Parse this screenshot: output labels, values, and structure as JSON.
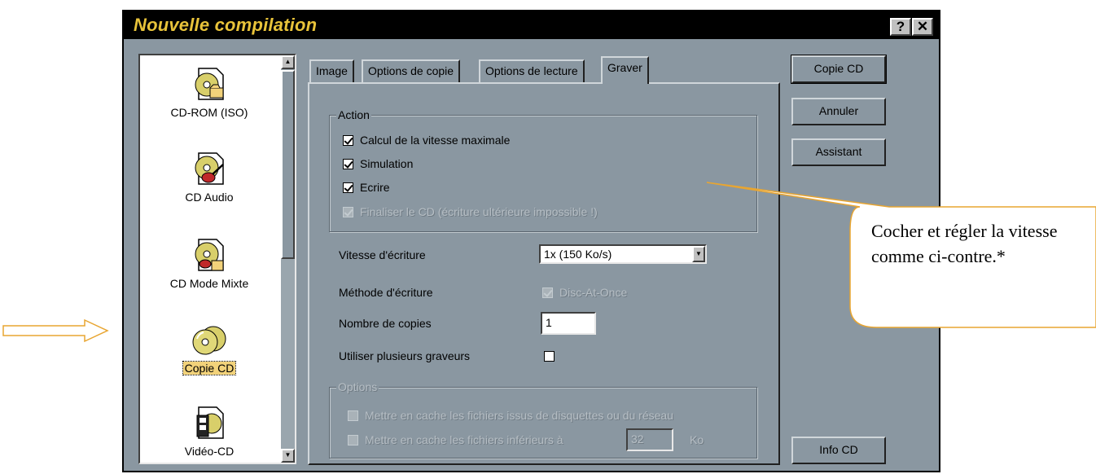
{
  "window": {
    "title": "Nouvelle compilation",
    "help_label": "?",
    "close_label": "✕"
  },
  "compilation_types": [
    {
      "label": "CD-ROM (ISO)",
      "icon": "cd-rom-document-icon",
      "selected": false
    },
    {
      "label": "CD Audio",
      "icon": "cd-audio-guitar-icon",
      "selected": false
    },
    {
      "label": "CD Mode Mixte",
      "icon": "cd-mixed-mode-icon",
      "selected": false
    },
    {
      "label": "Copie CD",
      "icon": "cd-copy-icon",
      "selected": true
    },
    {
      "label": "Vidéo-CD",
      "icon": "video-cd-film-icon",
      "selected": false
    }
  ],
  "tabs": [
    {
      "label": "Image",
      "active": false
    },
    {
      "label": "Options de copie",
      "active": false
    },
    {
      "label": "Options de lecture",
      "active": false
    },
    {
      "label": "Graver",
      "active": true
    }
  ],
  "action_group": {
    "title": "Action",
    "items": [
      {
        "label": "Calcul de la vitesse maximale",
        "checked": true,
        "enabled": true
      },
      {
        "label": "Simulation",
        "checked": true,
        "enabled": true
      },
      {
        "label": "Ecrire",
        "checked": true,
        "enabled": true
      },
      {
        "label": "Finaliser le CD (écriture ultérieure impossible !)",
        "checked": true,
        "enabled": false
      }
    ]
  },
  "write_speed": {
    "label": "Vitesse d'écriture",
    "value": "1x (150 Ko/s)"
  },
  "write_method": {
    "label": "Méthode d'écriture",
    "value": "Disc-At-Once",
    "checked": true,
    "enabled": false
  },
  "copies": {
    "label": "Nombre de copies",
    "value": "1"
  },
  "multiple_writers": {
    "label": "Utiliser plusieurs graveurs",
    "checked": false
  },
  "options_group": {
    "title": "Options",
    "cache_network": "Mettre en cache les fichiers issus de disquettes ou du réseau",
    "cache_smaller": "Mettre en cache les fichiers inférieurs à",
    "cache_size": "32",
    "cache_unit": "Ko"
  },
  "buttons": {
    "copy_cd": "Copie CD",
    "cancel": "Annuler",
    "wizard": "Assistant",
    "cd_info": "Info CD"
  },
  "annotation": {
    "callout_text": "Cocher et régler la vitesse comme ci-contre.*"
  },
  "colors": {
    "dialog_bg": "#8a97a1",
    "title_text": "#e8c33a",
    "selection": "#f2d27a",
    "callout_border": "#e8a531",
    "arrow": "#e8a531"
  }
}
